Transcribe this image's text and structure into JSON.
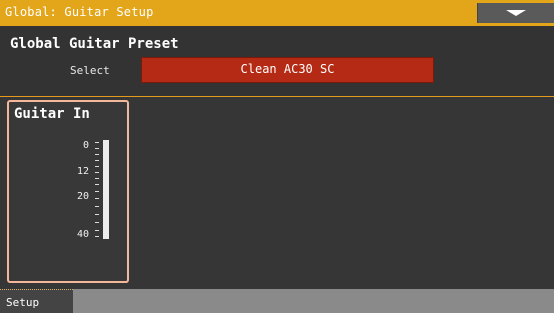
{
  "header": {
    "title": "Global: Guitar Setup"
  },
  "preset": {
    "heading": "Global Guitar Preset",
    "select_label": "Select",
    "select_value": "Clean AC30 SC",
    "field_color": "#b52a14"
  },
  "meter": {
    "heading": "Guitar In",
    "labels": [
      "0",
      "12",
      "20",
      "40"
    ],
    "level": 1.0
  },
  "tabs": [
    {
      "label": "Setup",
      "active": true
    }
  ],
  "colors": {
    "accent": "#e3a51a",
    "highlight": "#f3b89c"
  },
  "icons": {
    "menu": "chevron-down-icon"
  }
}
